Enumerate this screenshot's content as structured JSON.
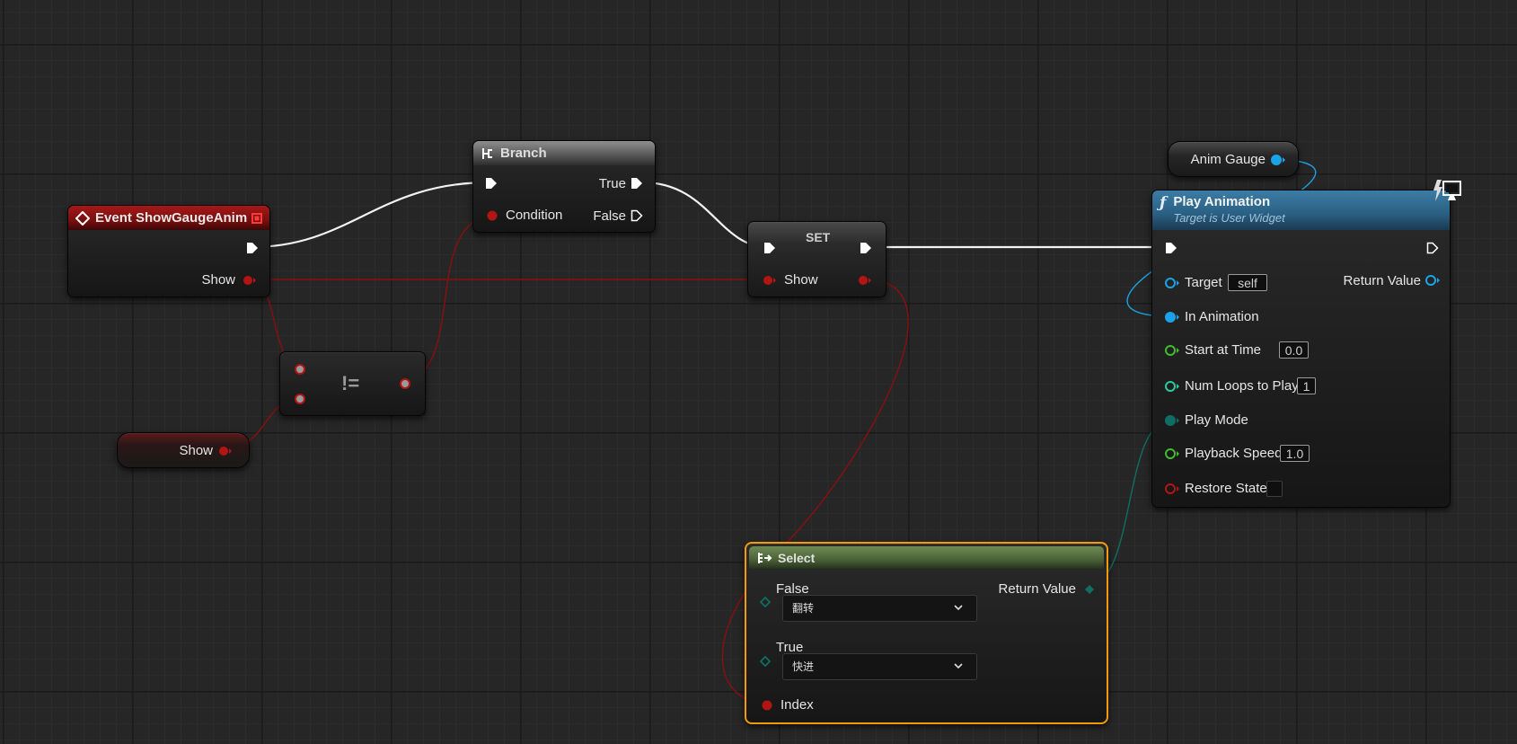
{
  "event_node": {
    "title": "Event ShowGaugeAnim",
    "show_label": "Show"
  },
  "branch_node": {
    "title": "Branch",
    "true_label": "True",
    "false_label": "False",
    "condition_label": "Condition"
  },
  "not_equal_node": {
    "symbol": "!="
  },
  "show_getter": {
    "label": "Show"
  },
  "set_node": {
    "title": "SET",
    "show_label": "Show"
  },
  "anim_gauge": {
    "label": "Anim Gauge"
  },
  "play_animation": {
    "title": "Play Animation",
    "subtitle": "Target is User Widget",
    "target_label": "Target",
    "target_value": "self",
    "return_label": "Return Value",
    "in_animation_label": "In Animation",
    "start_time_label": "Start at Time",
    "start_time_value": "0.0",
    "num_loops_label": "Num Loops to Play",
    "num_loops_value": "1",
    "play_mode_label": "Play Mode",
    "playback_speed_label": "Playback Speed",
    "playback_speed_value": "1.0",
    "restore_state_label": "Restore State"
  },
  "select_node": {
    "title": "Select",
    "false_label": "False",
    "false_value": "翻转",
    "true_label": "True",
    "true_value": "快进",
    "index_label": "Index",
    "return_label": "Return Value"
  },
  "colors": {
    "exec": "#ffffff",
    "bool": "#9b0c0c",
    "object": "#1aa3e8",
    "float": "#3fbe2c",
    "int": "#2ccaa0",
    "enum": "#0f6e63",
    "event_header": "#8e1212",
    "function_header": "#2e6f95",
    "select_header": "#526b3a",
    "selection": "#f39a0a"
  }
}
